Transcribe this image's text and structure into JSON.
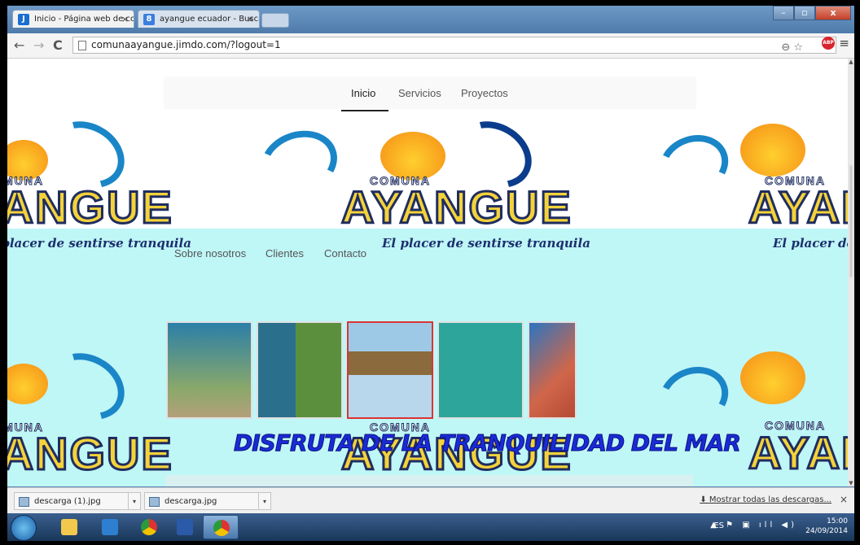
{
  "browser": {
    "tabs": [
      {
        "title": "Inicio - Página web de cor",
        "favicon": "J",
        "color": "#1b6fd0",
        "active": true
      },
      {
        "title": "ayangue ecuador - Buscar",
        "favicon": "8",
        "color": "#3c7ee0",
        "active": false
      }
    ],
    "url": "comunaayangue.jimdo.com/?logout=1",
    "window_buttons": {
      "minimize": "–",
      "maximize": "▫",
      "close": "x"
    }
  },
  "site": {
    "nav": {
      "top": [
        "Inicio",
        "Servicios",
        "Proyectos"
      ],
      "bottom": [
        "Sobre nosotros",
        "Clientes",
        "Contacto"
      ]
    },
    "logo": {
      "comuna": "COMUNA",
      "name": "AYANGUE",
      "tagline": "El placer de sentirse tranquila"
    },
    "banner_text": "DISFRUTA DE LA TRANQUILIDAD DEL MAR",
    "gallery": [
      "turtle",
      "diver-and-starfish",
      "coast-collage",
      "manta-ray",
      "beach"
    ]
  },
  "downloads": {
    "items": [
      "descarga (1).jpg",
      "descarga.jpg"
    ],
    "show_all": "Mostrar todas las descargas...",
    "close": "×"
  },
  "taskbar": {
    "language": "ES",
    "time": "15:00",
    "date": "24/09/2014"
  }
}
